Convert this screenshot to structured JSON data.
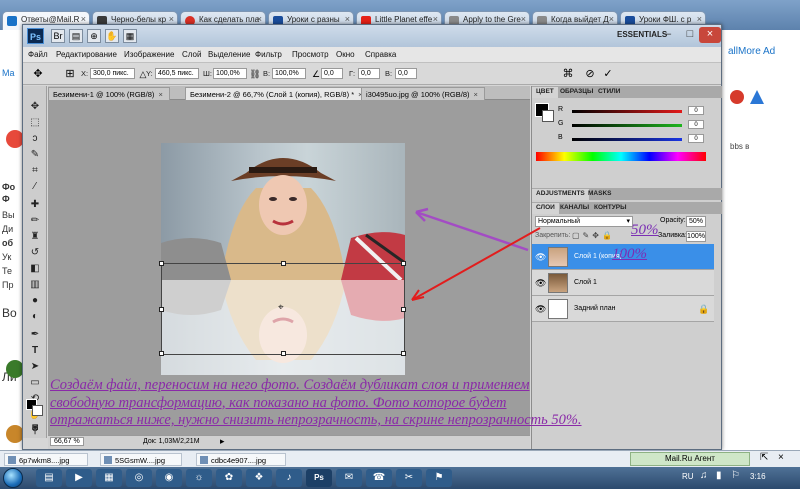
{
  "browser": {
    "tabs": [
      {
        "label": "Ответы@Mail.R",
        "color": "#1a73c8"
      },
      {
        "label": "Черно-белы кр",
        "color": "#3a3a3a"
      },
      {
        "label": "Как сделать пла",
        "color": "#d93025"
      },
      {
        "label": "Уроки с разны",
        "color": "#1a4d9c"
      },
      {
        "label": "Little Planet effe",
        "color": "#e62117"
      },
      {
        "label": "Apply to the Gre",
        "color": "#777777"
      },
      {
        "label": "Когда выйдет Д",
        "color": "#777777"
      },
      {
        "label": "Уроки ФШ. с р",
        "color": "#1a4d9c"
      }
    ],
    "left_strip": [
      "Ma",
      "Фо",
      "Ф",
      "Вы",
      "Ди",
      "об",
      "Ук",
      "Те",
      "Пр",
      "Во",
      "Ли"
    ],
    "right_strip": [
      "allMore Ad",
      "bbs в"
    ]
  },
  "photoshop": {
    "logo": "Ps",
    "workspace": "ESSENTIALS",
    "menu": [
      "Файл",
      "Редактирование",
      "Изображение",
      "Слой",
      "Выделение",
      "Фильтр",
      "Просмотр",
      "Окно",
      "Справка"
    ],
    "options": {
      "x_label": "X:",
      "x_value": "300,0 пикс.",
      "y_label": "Y:",
      "y_value": "460,5 пикс.",
      "w_label": "Ш:",
      "w_value": "100,0%",
      "h_label": "В:",
      "h_value": "100,0%",
      "angle_value": "0,0",
      "hskew_label": "Г:",
      "hskew_value": "0,0",
      "vskew_label": "В:",
      "vskew_value": "0,0"
    },
    "doc_tabs": [
      {
        "label": "Безимени-1 @ 100% (RGB/8)"
      },
      {
        "label": "Безимени-2 @ 66,7% (Слой 1 (копия), RGB/8) *"
      },
      {
        "label": "i30495uo.jpg @ 100% (RGB/8)"
      }
    ],
    "status": {
      "zoom": "66,67 %",
      "doc": "Док: 1,03M/2,21M"
    },
    "color_panel": {
      "tabs": [
        "ЦВЕТ",
        "ОБРАЗЦЫ",
        "СТИЛИ"
      ],
      "channels": [
        {
          "label": "R",
          "value": "0",
          "color": "#e21a1a"
        },
        {
          "label": "G",
          "value": "0",
          "color": "#1fb51f"
        },
        {
          "label": "B",
          "value": "0",
          "color": "#1a35e2"
        }
      ]
    },
    "adjust_tabs": [
      "ADJUSTMENTS",
      "MASKS"
    ],
    "layers_panel": {
      "tabs": [
        "СЛОИ",
        "КАНАЛЫ",
        "КОНТУРЫ"
      ],
      "blend_mode": "Нормальный",
      "opacity_label": "Opacity:",
      "opacity_value": "50%",
      "lock_label": "Закрепить:",
      "fill_label": "Заливка:",
      "fill_value": "100%",
      "layers": [
        {
          "name": "Слой 1 (копия)",
          "selected": true
        },
        {
          "name": "Слой 1",
          "selected": false
        },
        {
          "name": "Задний план",
          "selected": false
        }
      ]
    }
  },
  "annotations": {
    "note_copy_opacity": "50%",
    "note_original_opacity": "100%",
    "caption_line1": "Создаём файл, переносим на него фото. Создаём дубликат слоя и применяем",
    "caption_line2": "свободную трансформацию,  как показано на фото.  Фото которое будет",
    "caption_line3": "отражаться ниже, нужно снизить непрозрачность, на скрине непрозрачность 50%."
  },
  "downloads": [
    {
      "label": "6p7wkm8....jpg"
    },
    {
      "label": "5SGsmW....jpg"
    },
    {
      "label": "cdbc4e907....jpg"
    }
  ],
  "agent_label": "Mail.Ru Агент",
  "taskbar": {
    "lang": "RU",
    "time": "3:16"
  }
}
